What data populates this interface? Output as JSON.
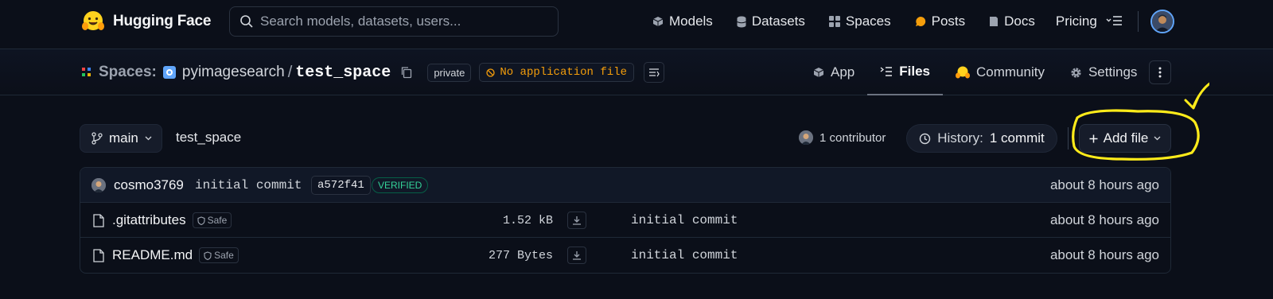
{
  "nav": {
    "brand": "Hugging Face",
    "search_placeholder": "Search models, datasets, users...",
    "links": [
      {
        "label": "Models",
        "icon": "cube-icon"
      },
      {
        "label": "Datasets",
        "icon": "database-icon"
      },
      {
        "label": "Spaces",
        "icon": "grid-icon"
      },
      {
        "label": "Posts",
        "icon": "chat-bubble-icon"
      },
      {
        "label": "Docs",
        "icon": "book-icon"
      },
      {
        "label": "Pricing",
        "icon": ""
      }
    ]
  },
  "repo": {
    "section": "Spaces:",
    "owner": "pyimagesearch",
    "separator": "/",
    "name": "test_space",
    "visibility": "private",
    "status": "No application file",
    "tabs": [
      {
        "label": "App",
        "icon": "cube-icon"
      },
      {
        "label": "Files",
        "icon": "files-icon",
        "active": true
      },
      {
        "label": "Community",
        "icon": "hug-icon"
      },
      {
        "label": "Settings",
        "icon": "gear-icon"
      }
    ]
  },
  "branch": {
    "name": "main",
    "path": "test_space",
    "contributors": "1 contributor",
    "history_label": "History:",
    "history_value": "1 commit",
    "add_file": "Add file"
  },
  "last_commit": {
    "user": "cosmo3769",
    "message": "initial commit",
    "sha": "a572f41",
    "verified": "VERIFIED",
    "time": "about 8 hours ago"
  },
  "files": [
    {
      "name": ".gitattributes",
      "safe": "Safe",
      "size": "1.52 kB",
      "commit": "initial commit",
      "time": "about 8 hours ago"
    },
    {
      "name": "README.md",
      "safe": "Safe",
      "size": "277 Bytes",
      "commit": "initial commit",
      "time": "about 8 hours ago"
    }
  ],
  "colors": {
    "background": "#0b0f19",
    "accent_yellow": "#ffeb1a",
    "warning": "#f59e0b",
    "verified": "#34d399"
  }
}
